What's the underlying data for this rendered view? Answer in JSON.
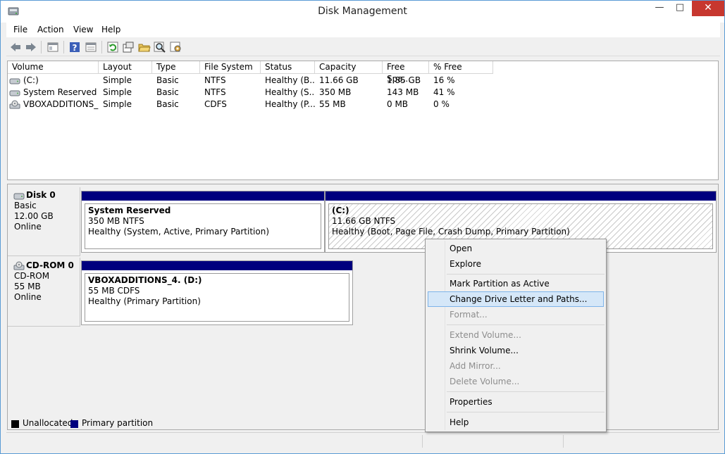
{
  "window": {
    "title": "Disk Management"
  },
  "menu": [
    "File",
    "Action",
    "View",
    "Help"
  ],
  "toolbar_icons": [
    "back-icon",
    "forward-icon",
    "console-tree-icon",
    "help-icon",
    "properties-view-icon",
    "refresh-icon",
    "rescan-icon",
    "open-icon",
    "search-icon",
    "settings-icon"
  ],
  "volume_list": {
    "columns": [
      "Volume",
      "Layout",
      "Type",
      "File System",
      "Status",
      "Capacity",
      "Free Spa...",
      "% Free"
    ],
    "rows": [
      [
        "(C:)",
        "Simple",
        "Basic",
        "NTFS",
        "Healthy (B...",
        "11.66 GB",
        "1.85 GB",
        "16 %"
      ],
      [
        "System Reserved",
        "Simple",
        "Basic",
        "NTFS",
        "Healthy (S...",
        "350 MB",
        "143 MB",
        "41 %"
      ],
      [
        "VBOXADDITIONS_...",
        "Simple",
        "Basic",
        "CDFS",
        "Healthy (P...",
        "55 MB",
        "0 MB",
        "0 %"
      ]
    ]
  },
  "disks": [
    {
      "name": "Disk 0",
      "type": "Basic",
      "size": "12.00 GB",
      "state": "Online",
      "partitions": [
        {
          "name": "System Reserved",
          "fs": "350 MB NTFS",
          "status": "Healthy (System, Active, Primary Partition)"
        },
        {
          "name": "(C:)",
          "fs": "11.66 GB NTFS",
          "status": "Healthy (Boot, Page File, Crash Dump, Primary Partition)"
        }
      ]
    },
    {
      "name": "CD-ROM 0",
      "type": "CD-ROM",
      "size": "55 MB",
      "state": "Online",
      "partitions": [
        {
          "name": "VBOXADDITIONS_4.  (D:)",
          "fs": "55 MB CDFS",
          "status": "Healthy (Primary Partition)"
        }
      ]
    }
  ],
  "legend": {
    "unallocated": "Unallocated",
    "primary": "Primary partition",
    "unallocated_color": "#000000",
    "primary_color": "#00007e"
  },
  "context_menu": {
    "items": [
      {
        "label": "Open",
        "enabled": true
      },
      {
        "label": "Explore",
        "enabled": true
      },
      {
        "label": "Mark Partition as Active",
        "enabled": true
      },
      {
        "label": "Change Drive Letter and Paths...",
        "enabled": true,
        "highlighted": true
      },
      {
        "label": "Format...",
        "enabled": false
      },
      {
        "label": "Extend Volume...",
        "enabled": false
      },
      {
        "label": "Shrink Volume...",
        "enabled": true
      },
      {
        "label": "Add Mirror...",
        "enabled": false
      },
      {
        "label": "Delete Volume...",
        "enabled": false
      },
      {
        "label": "Properties",
        "enabled": true
      },
      {
        "label": "Help",
        "enabled": true
      }
    ]
  }
}
